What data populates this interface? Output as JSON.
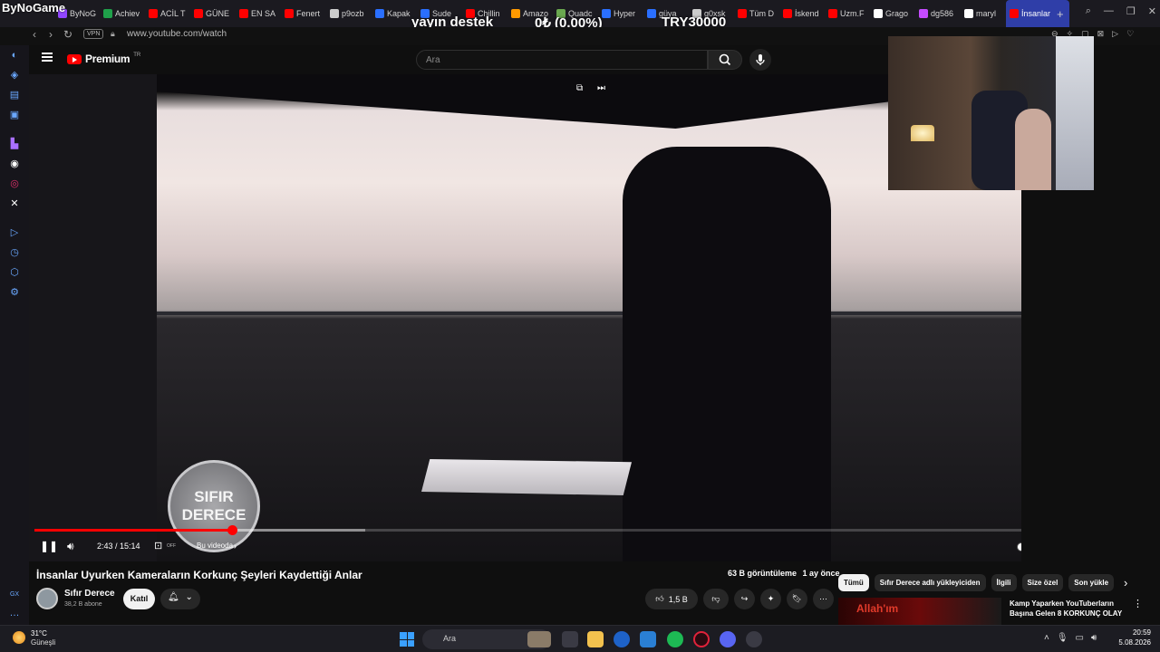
{
  "overlay": {
    "channel_mark": "ByNoGame",
    "donation_label": "yayın destek",
    "donation_amount": "0₺ (0.00%)",
    "donation_goal": "TRY30000"
  },
  "browser": {
    "tabs": [
      {
        "label": "ByNoG",
        "color": "#9146ff"
      },
      {
        "label": "Achiev",
        "color": "#1fa04a"
      },
      {
        "label": "ACİL T",
        "color": "#ff0000"
      },
      {
        "label": "GÜNE",
        "color": "#ff0000"
      },
      {
        "label": "EN SA",
        "color": "#ff0000"
      },
      {
        "label": "Fenert",
        "color": "#ff0000"
      },
      {
        "label": "p9ozb",
        "color": "#cccccc"
      },
      {
        "label": "Kapak",
        "color": "#2a6fff"
      },
      {
        "label": "Sude",
        "color": "#2a6fff"
      },
      {
        "label": "Chillin",
        "color": "#ff0000"
      },
      {
        "label": "Amazo",
        "color": "#ff9900"
      },
      {
        "label": "Quadc",
        "color": "#6aa84f"
      },
      {
        "label": "Hyper",
        "color": "#2a6fff"
      },
      {
        "label": "güya",
        "color": "#2a6fff"
      },
      {
        "label": "g0xsk",
        "color": "#cccccc"
      },
      {
        "label": "Tüm D",
        "color": "#ff0000"
      },
      {
        "label": "İskend",
        "color": "#ff0000"
      },
      {
        "label": "Uzm.F",
        "color": "#ff0000"
      },
      {
        "label": "Grago",
        "color": "#ffffff"
      },
      {
        "label": "dg586",
        "color": "#c54bff"
      },
      {
        "label": "maryl",
        "color": "#ffffff"
      },
      {
        "label": "İnsanlar",
        "color": "#ff0000",
        "active": true
      }
    ],
    "new_tab": "+",
    "vpn": "VPN",
    "url": "www.youtube.com/watch"
  },
  "youtube": {
    "brand": "Premium",
    "region": "TR",
    "search_placeholder": "Ara"
  },
  "player": {
    "logo_line1": "SIFIR",
    "logo_line2": "DERECE",
    "time_display": "2:43 / 15:14",
    "cc_state": "OFF",
    "chapter": "Bu videoda",
    "progress_played": 0.2,
    "progress_buffered": 0.335
  },
  "video": {
    "title": "İnsanlar Uyurken Kameraların Korkunç Şeyleri Kaydettiği Anlar",
    "channel": "Sıfır Derece",
    "subscribers": "38,2 B abone",
    "join_label": "Katıl",
    "views": "63 B görüntüleme",
    "age": "1 ay önce",
    "likes": "1,5 B"
  },
  "chips": [
    {
      "label": "Tümü",
      "active": true
    },
    {
      "label": "Sıfır Derece adlı yükleyiciden"
    },
    {
      "label": "İlgili"
    },
    {
      "label": "Size özel"
    },
    {
      "label": "Son yükle"
    }
  ],
  "recommendation": {
    "thumb_text": "Allah'ım",
    "title": "Kamp Yaparken YouTuberların Başına Gelen 8 KORKUNÇ OLAY"
  },
  "taskbar": {
    "temp": "31°C",
    "weather": "Güneşli",
    "search_label": "Ara",
    "time": "20:59",
    "date": "5.08.2026"
  }
}
